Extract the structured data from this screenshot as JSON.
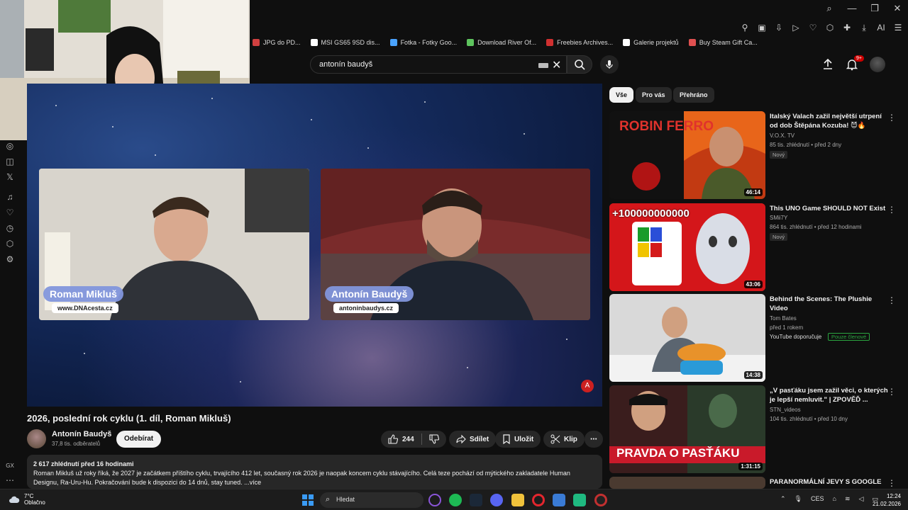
{
  "browser": {
    "bookmarks": [
      {
        "label": "JPG do PD...",
        "color": "#d04040"
      },
      {
        "label": "MSI GS65 9SD dis...",
        "color": "#ffffff"
      },
      {
        "label": "Fotka - Fotky Goo...",
        "color": "#4aa3ff"
      },
      {
        "label": "Download River Of...",
        "color": "#5ec45e"
      },
      {
        "label": "Freebies Archives...",
        "color": "#d03030"
      },
      {
        "label": "Galerie projektů",
        "color": "#ffffff"
      },
      {
        "label": "Buy Steam Gift Ca...",
        "color": "#e05050"
      }
    ]
  },
  "search": {
    "query": "antonín baudyš"
  },
  "header": {
    "notif_badge": "9+"
  },
  "video": {
    "guest_left_name": "Roman Mikluš",
    "guest_left_site": "www.DNAcesta.cz",
    "guest_right_name": "Antonín Baudyš",
    "guest_right_site": "antoninbaudys.cz",
    "title": "2026, poslední rok cyklu (1. díl, Roman Mikluš)",
    "channel": "Antonín Baudyš",
    "subscribers": "37,8 tis. odběratelů",
    "subscribe_label": "Odebírat",
    "likes": "244",
    "share_label": "Sdílet",
    "save_label": "Uložit",
    "clip_label": "Klip",
    "stats": "2 617 zhlédnutí  před 16 hodinami",
    "description": "Roman Mikluš už roky říká, že 2027 je začátkem příštího cyklu, trvajícího 412 let, současný rok 2026 je naopak koncem cyklu stávajícího. Celá teze pochází od mýtického zakladatele Human Designu, Ra-Uru-Hu. Pokračování bude k dispozici do 14 dnů, stay tuned. ...více"
  },
  "chips": [
    "Vše",
    "Pro vás",
    "Přehráno"
  ],
  "recommendations": [
    {
      "title": "Italský Valach zažil největší utrpení od dob Štěpána Kozuba! 😈🔥",
      "channel": "V.O.X. TV",
      "meta": "85 tis. zhlédnutí • před 2 dny",
      "badge": "Nový",
      "duration": "46:14",
      "thumb_text": "ROBIN FERRO"
    },
    {
      "title": "This UNO Game SHOULD NOT Exist",
      "channel": "SMii7Y",
      "meta": "864 tis. zhlédnutí • před 12 hodinami",
      "badge": "Nový",
      "duration": "43:06",
      "thumb_text": "+100000000000"
    },
    {
      "title": "Behind the Scenes: The Plushie Video",
      "channel": "Tom Bates",
      "meta": "před 1 rokem",
      "extra": "YouTube doporučuje",
      "member": "Pouze členové",
      "duration": "14:38"
    },
    {
      "title": "„V pasťáku jsem zažil věci, o kterých je lepší nemluvit.\" | ZPOVĚĎ ...",
      "channel": "STN_videos",
      "meta": "104 tis. zhlédnutí • před 10 dny",
      "duration": "1:31:15",
      "thumb_text": "PRAVDA O PASŤÁKU"
    },
    {
      "title": "PARANORMÁLNÍ JEVY S GOOGLE"
    }
  ],
  "taskbar": {
    "temp": "7°C",
    "weather": "Oblačno",
    "search_label": "Hledat",
    "lang": "CES",
    "time": "12:24",
    "date": "21.02.2026"
  }
}
